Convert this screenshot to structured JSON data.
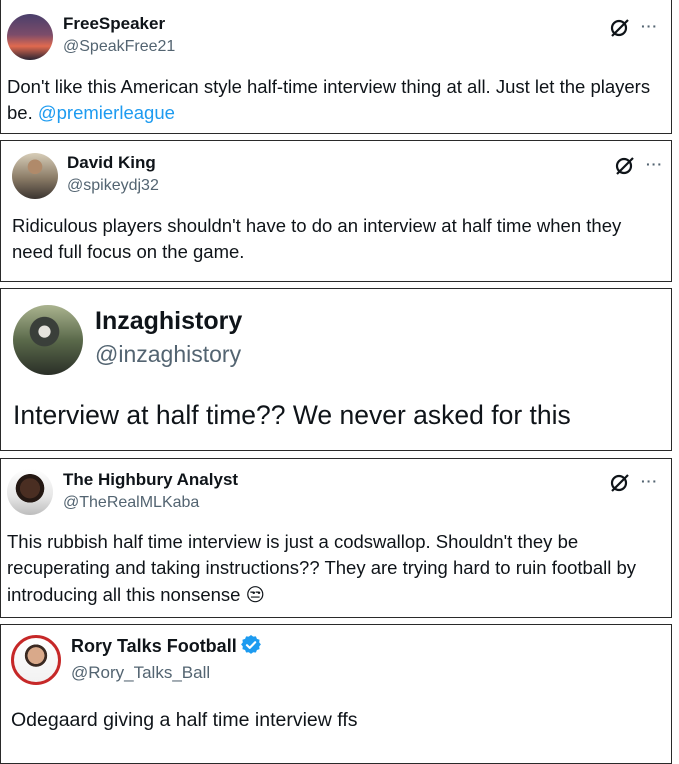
{
  "tweets": [
    {
      "name": "FreeSpeaker",
      "handle": "@SpeakFree21",
      "text": "Don't like this American style half-time interview thing at all. Just let the players be. ",
      "mention": "@premierleague",
      "avatar_colors": [
        "#3a2f55",
        "#d9574c"
      ]
    },
    {
      "name": "David King",
      "handle": "@spikeydj32",
      "text": "Ridiculous players shouldn't have to do an interview at half time when they need full focus on the game.",
      "avatar_colors": [
        "#c9b9a0",
        "#4a3a2d"
      ]
    },
    {
      "name": "Inzaghistory",
      "handle": "@inzaghistory",
      "text": "Interview at half time?? We never asked for this",
      "avatar_colors": [
        "#6f7c5a",
        "#1d2630"
      ]
    },
    {
      "name": "The Highbury Analyst",
      "handle": "@TheRealMLKaba",
      "text": "This rubbish half time interview is just a codswallop. Shouldn't they be recuperating and taking instructions?? They are trying hard to ruin football by introducing all this nonsense ",
      "emoji": "😒",
      "avatar_colors": [
        "#f0f0f0",
        "#2b1e18"
      ]
    },
    {
      "name": "Rory Talks Football",
      "handle": "@Rory_Talks_Ball",
      "text": "Odegaard giving a half time interview ffs",
      "avatar_colors": [
        "#ffffff",
        "#c62828"
      ],
      "verified": true
    }
  ],
  "ui": {
    "more_label": "···",
    "accent": "#1d9bf0"
  }
}
